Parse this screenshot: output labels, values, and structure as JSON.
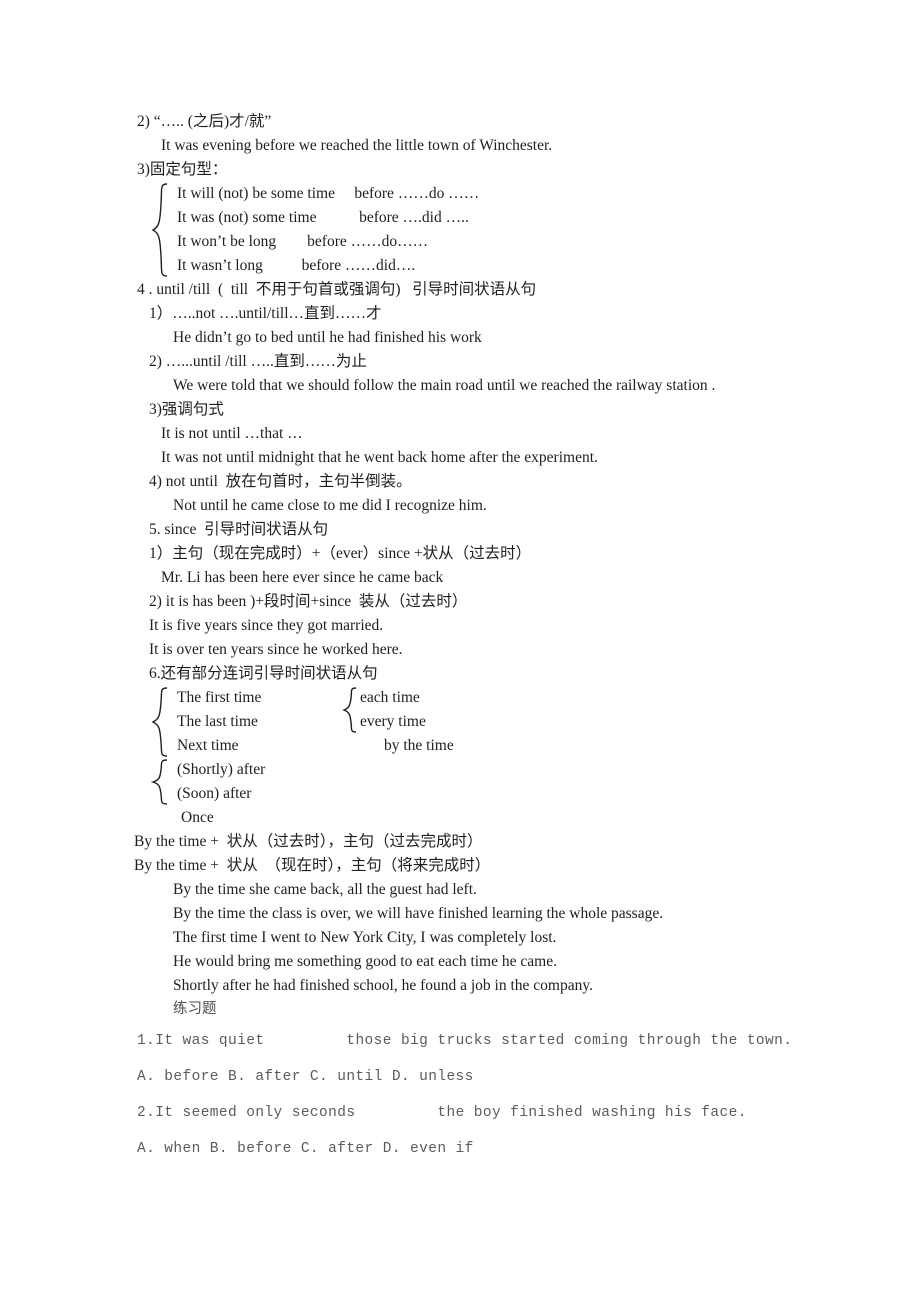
{
  "document": {
    "section_before_2": {
      "heading": "2) “….. (之后)才/就”",
      "example": "It was evening before we reached the little town of Winchester."
    },
    "section_before_3": {
      "heading": "3)固定句型：",
      "brace_rows": [
        "It will (not) be some time     before ……do ……",
        "It was (not) some time           before ….did …..",
        "It won’t be long        before ……do……",
        "It wasn’t long          before ……did…."
      ]
    },
    "section_until": {
      "heading": "4 . until /till  (  till  不用于句首或强调句)   引导时间状语从句",
      "items": [
        {
          "label": "1）…..not ….until/till…直到……才",
          "example": "He didn’t go to bed until he had finished his work"
        },
        {
          "label": "2) …...until /till …..直到……为止",
          "example": "We were told that we should follow the main road until we reached the railway station ."
        }
      ],
      "emphatic": {
        "label": "3)强调句式",
        "pattern": "It is not until …that …",
        "example": "It was not until midnight that he went back home after the experiment."
      },
      "inversion": {
        "label": "4) not until  放在句首时，主句半倒装。",
        "example": "Not until he came close to me did I recognize him."
      }
    },
    "section_since": {
      "heading": "5. since  引导时间状语从句",
      "items": [
        {
          "label": "1）主句（现在完成时）+（ever）since +状从（过去时）",
          "example": "Mr. Li has been here ever since he came back"
        },
        {
          "label": "2) it is has been )+段时间+since  装从（过去时）",
          "examples": [
            "It is five years since they got married.",
            "It is over ten years since he worked here."
          ]
        }
      ]
    },
    "section_other_conjunctions": {
      "heading": "6.还有部分连词引导时间状语从句",
      "left_brace_group_1": [
        "The first time",
        "The last time",
        "Next time"
      ],
      "left_brace_group_2": [
        "(Shortly) after",
        "(Soon) after"
      ],
      "left_unbraced": "Once",
      "right_brace_group": [
        "each time",
        "every time"
      ],
      "right_unbraced": "by the time"
    },
    "section_by_the_time": {
      "patterns": [
        "By the time +  状从（过去时），主句（过去完成时）",
        "By the time +  状从  （现在时），主句（将来完成时）"
      ],
      "examples": [
        "By the time she came back, all the guest had left.",
        "By the time the class is over, we will have finished learning the whole passage.",
        "The first time I went to New York City, I was completely lost.",
        "He would bring me something good to eat each time he came.",
        "Shortly after he had finished school, he found a job in the company."
      ]
    },
    "exercises": {
      "heading": "练习题",
      "questions": [
        {
          "number": "1.",
          "stem_before": "It was quiet ",
          "blank": "_______",
          "stem_after": " those big trucks started coming through the town.",
          "options": "A. before B. after C. until D. unless"
        },
        {
          "number": "2.",
          "stem_before": "It seemed only seconds ",
          "blank": "_______",
          "stem_after": " the boy finished washing his face.",
          "options": "A. when B. before C. after D. even if"
        }
      ]
    }
  }
}
